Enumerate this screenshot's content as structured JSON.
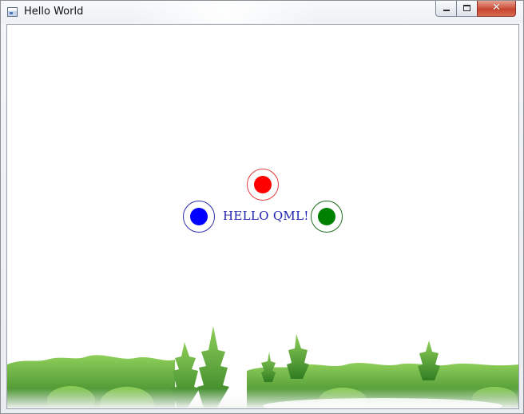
{
  "window": {
    "title": "Hello World",
    "controls": {
      "minimize_icon": "minimize-icon",
      "maximize_icon": "maximize-icon",
      "close_icon": "close-icon",
      "close_glyph": "✕"
    }
  },
  "content": {
    "label": "HELLO QML!",
    "label_color": "#2020b0",
    "background": "#ffffff",
    "dots": [
      {
        "id": "red",
        "color": "#ff0000",
        "ring": "#e03a3a"
      },
      {
        "id": "blue",
        "color": "#0000ff",
        "ring": "#2a2aa8"
      },
      {
        "id": "green",
        "color": "#008000",
        "ring": "#1d6e1d"
      }
    ],
    "scenery": "forest-treeline-image"
  }
}
